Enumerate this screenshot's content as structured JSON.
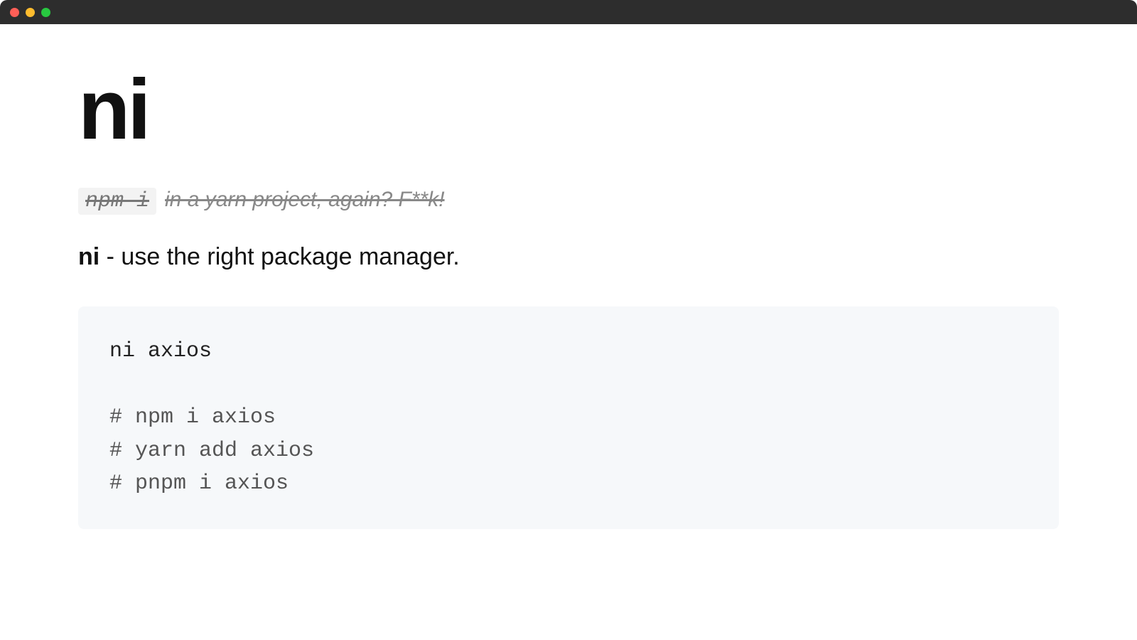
{
  "header": {
    "title": "ni"
  },
  "strikethrough": {
    "code": "npm i",
    "rest": "in a yarn project, again? F**k!"
  },
  "tagline": {
    "bold": "ni",
    "rest": " - use the right package manager."
  },
  "code": {
    "cmd": "ni axios",
    "comments": [
      "# npm i axios",
      "# yarn add axios",
      "# pnpm i axios"
    ]
  }
}
